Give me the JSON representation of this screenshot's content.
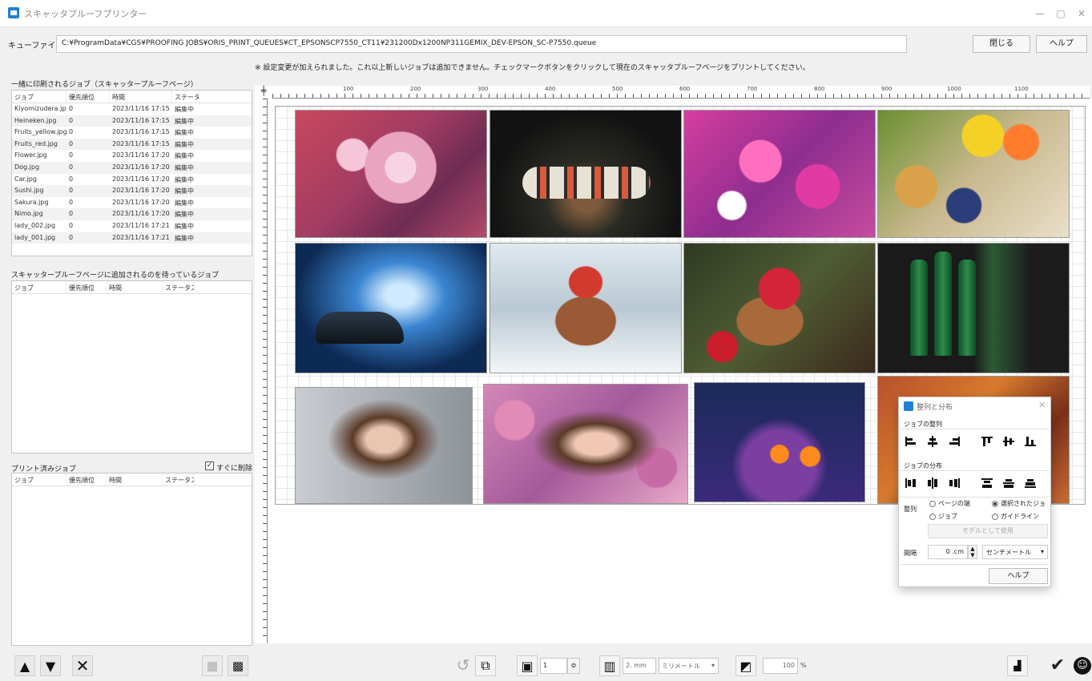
{
  "window": {
    "title": "スキャッタプルーフプリンター",
    "minimize": "—",
    "maximize": "▢",
    "close": "✕"
  },
  "queue": {
    "label": "キューファイル",
    "path": "C:¥ProgramData¥CGS¥PROOFING JOBS¥ORIS_PRINT_QUEUES¥CT_EPSONSCP7550_CT11¥231200Dx1200NP311GEMIX_DEV-EPSON_SC-P7550.queue",
    "close_label": "閉じる",
    "help_label": "ヘルプ"
  },
  "notice": "※ 設定変更が加えられました。これ以上新しいジョブは追加できません。チェックマークボタンをクリックして現在のスキャッタプルーフページをプリントしてください。",
  "queued_jobs": {
    "title": "一緒に印刷されるジョブ（スキャッタープルーフページ）",
    "columns": [
      "ジョブ",
      "優先順位",
      "時間",
      "ステータス"
    ],
    "rows": [
      [
        "Kiyomizudera.jpg",
        "0",
        "2023/11/16 17:15",
        "編集中"
      ],
      [
        "Heineken.jpg",
        "0",
        "2023/11/16 17:15",
        "編集中"
      ],
      [
        "Fruits_yellow.jpg",
        "0",
        "2023/11/16 17:15",
        "編集中"
      ],
      [
        "Fruits_red.jpg",
        "0",
        "2023/11/16 17:15",
        "編集中"
      ],
      [
        "Flower.jpg",
        "0",
        "2023/11/16 17:20",
        "編集中"
      ],
      [
        "Dog.jpg",
        "0",
        "2023/11/16 17:20",
        "編集中"
      ],
      [
        "Car.jpg",
        "0",
        "2023/11/16 17:20",
        "編集中"
      ],
      [
        "Sushi.jpg",
        "0",
        "2023/11/16 17:20",
        "編集中"
      ],
      [
        "Sakura.jpg",
        "0",
        "2023/11/16 17:20",
        "編集中"
      ],
      [
        "Nimo.jpg",
        "0",
        "2023/11/16 17:20",
        "編集中"
      ],
      [
        "lady_002.jpg",
        "0",
        "2023/11/16 17:21",
        "編集中"
      ],
      [
        "lady_001.jpg",
        "0",
        "2023/11/16 17:21",
        "編集中"
      ]
    ]
  },
  "waiting_jobs": {
    "title": "スキャッタープルーフページに追加されるのを待っているジョブ",
    "columns": [
      "ジョブ",
      "優先順位",
      "時間",
      "ステータス"
    ]
  },
  "printed_jobs": {
    "title": "プリント済みジョブ",
    "columns": [
      "ジョブ",
      "優先順位",
      "時間",
      "ステータス"
    ],
    "delete_now_label": "すぐに削除",
    "delete_now_checked": true
  },
  "toolbar": {
    "copies": "1",
    "spacing": "2. mm",
    "spacing_unit": "ミリメートル",
    "zoom": "100",
    "zoom_unit": "%"
  },
  "ruler": {
    "numbers": [
      "100",
      "200",
      "300",
      "400",
      "500",
      "600",
      "700",
      "800",
      "900",
      "1000",
      "1100"
    ]
  },
  "dialog": {
    "title": "整列と分布",
    "align_section": "ジョブの整列",
    "distribute_section": "ジョブの分布",
    "align_to_label": "整列",
    "option_page_edge": "ページの端",
    "option_selected_job": "選択されたジョ",
    "option_job": "ジョブ",
    "option_guide": "ガイドライン",
    "use_as_reference": "モデルとして使用",
    "spacing_label": "間隔",
    "spacing_value": "0 .cm",
    "spacing_unit": "センチメートル",
    "help_label": "ヘルプ"
  },
  "colors": {
    "accent": "#1f7fd8",
    "window_bg": "#f0f0f0"
  }
}
